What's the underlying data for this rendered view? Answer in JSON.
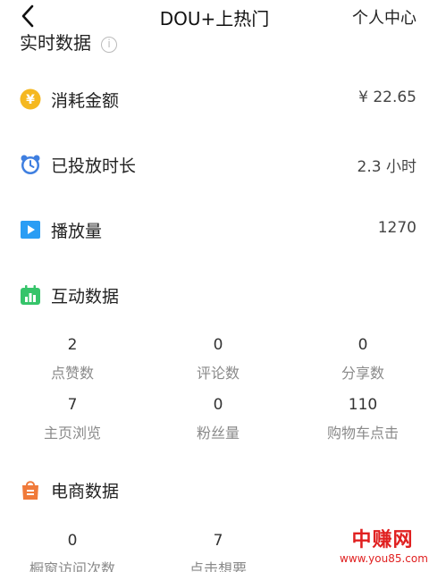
{
  "nav": {
    "title": "DOU+上热门",
    "right": "个人中心"
  },
  "realtime": {
    "title": "实时数据"
  },
  "rows": [
    {
      "label": "消耗金额",
      "value": "¥ 22.65",
      "icon": "coin-icon"
    },
    {
      "label": "已投放时长",
      "value": "2.3 小时",
      "icon": "alarm-clock-icon"
    },
    {
      "label": "播放量",
      "value": "1270",
      "icon": "play-icon"
    }
  ],
  "interaction": {
    "title": "互动数据",
    "stats": [
      {
        "value": "2",
        "label": "点赞数"
      },
      {
        "value": "0",
        "label": "评论数"
      },
      {
        "value": "0",
        "label": "分享数"
      },
      {
        "value": "7",
        "label": "主页浏览"
      },
      {
        "value": "0",
        "label": "粉丝量"
      },
      {
        "value": "110",
        "label": "购物车点击"
      }
    ]
  },
  "ecommerce": {
    "title": "电商数据",
    "stats": [
      {
        "value": "0",
        "label": "橱窗访问次数"
      },
      {
        "value": "7",
        "label": "点击想要"
      }
    ]
  },
  "watermark": {
    "brand": "中赚网",
    "url": "www.you85.com"
  },
  "colors": {
    "coin": "#f5b820",
    "clock": "#3f7fe0",
    "play": "#2a9df4",
    "interaction": "#36c46a",
    "ecommerce": "#f07a3a",
    "watermark": "#e02020"
  }
}
